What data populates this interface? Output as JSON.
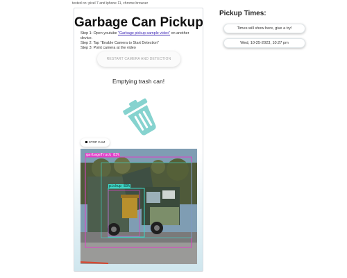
{
  "top_note": "tested on: pixel 7 and iphone 11, chrome browser",
  "card": {
    "title": "Garbage Can Pickup",
    "steps": {
      "step1_prefix": "Step 1: Open youtube ",
      "step1_link": "\"Garbage pickup sample video\"",
      "step1_suffix": " on another device.",
      "step2": "Step 2: Tap \"Enable Camera to Start Detection\"",
      "step3": "Step 3: Point camera at the video"
    },
    "restart_button": "RESTART CAMERA AND DETECTION",
    "status": "Emptying trash can!",
    "stop_button": "STOP CAM",
    "detections": {
      "label_truck": "garbageTruck 83%",
      "label_pickup": "pickup 83%"
    }
  },
  "pickup_times": {
    "title": "Pickup Times:",
    "entries": [
      "Times will show here, give a try!",
      "Wed, 10-25-2023, 10:27 pm"
    ]
  },
  "colors": {
    "icon_teal": "#86d3cf",
    "link": "#3d27b5",
    "bbox_truck": "#e040c8",
    "bbox_pickup": "#3fd6c6"
  },
  "icons": {
    "trash": "tilted-trash-can-icon",
    "stop": "stop-square-icon"
  }
}
